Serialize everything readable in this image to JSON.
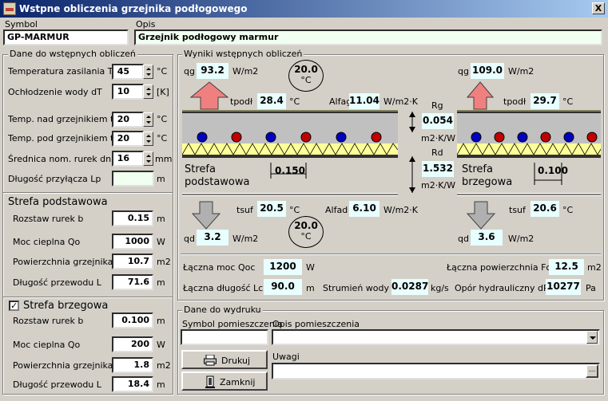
{
  "window": {
    "title": "Wstpne obliczenia grzejnika podłogowego",
    "close": "X"
  },
  "symbol": {
    "label": "Symbol",
    "value": "GP-MARMUR"
  },
  "opis": {
    "label": "Opis",
    "value": "Grzejnik podłogowy marmur"
  },
  "inputs": {
    "title": "Dane do wstępnych obliczeń",
    "tz": {
      "label": "Temperatura zasilania  Tz",
      "value": "45",
      "unit": "°C"
    },
    "dt": {
      "label": "Ochłodzenie wody dT",
      "value": "10",
      "unit": "[K]"
    },
    "tig": {
      "label": "Temp. nad grzejnikiem tig",
      "value": "20",
      "unit": "°C"
    },
    "tid": {
      "label": "Temp. pod grzejnikiem tid",
      "value": "20",
      "unit": "°C"
    },
    "dn": {
      "label": "Średnica nom. rurek dn",
      "value": "16",
      "unit": "mm"
    },
    "lp": {
      "label": "Długość przyłącza Lp",
      "value": "",
      "unit": "m"
    }
  },
  "strefa_podst": {
    "title": "Strefa podstawowa",
    "b": {
      "label": "Rozstaw rurek b",
      "value": "0.15",
      "unit": "m"
    },
    "qo": {
      "label": "Moc cieplna Qo",
      "value": "1000",
      "unit": "W"
    },
    "f": {
      "label": "Powierzchnia grzejnika F",
      "value": "10.7",
      "unit": "m2"
    },
    "l": {
      "label": "Długość przewodu L",
      "value": "71.6",
      "unit": "m"
    }
  },
  "strefa_brzeg": {
    "title": "Strefa brzegowa",
    "checked": "✓",
    "b": {
      "label": "Rozstaw rurek b",
      "value": "0.100",
      "unit": "m"
    },
    "qo": {
      "label": "Moc cieplna Qo",
      "value": "200",
      "unit": "W"
    },
    "f": {
      "label": "Powierzchnia grzejnika F",
      "value": "1.8",
      "unit": "m2"
    },
    "l": {
      "label": "Długość przewodu L",
      "value": "18.4",
      "unit": "m"
    }
  },
  "results": {
    "title": "Wyniki wstępnych obliczeń",
    "left": {
      "qg_label": "qg",
      "qg": "93.2",
      "qg_unit": "W/m2",
      "tig_circle": "20.0",
      "tig_unit": "°C",
      "tpodl_label": "tpodł",
      "tpodl": "28.4",
      "tpodl_unit": "°C",
      "alfag_label": "Alfag",
      "alfag": "11.04",
      "alfag_unit": "W/m2·K",
      "zone_text_1": "Strefa",
      "zone_text_2": "podstawowa",
      "spacing": "0.150",
      "tsuf_label": "tsuf",
      "tsuf": "20.5",
      "tsuf_unit": "°C",
      "alfad_label": "Alfad",
      "alfad": "6.10",
      "alfad_unit": "W/m2·K",
      "tid_circle": "20.0",
      "tid_unit": "°C",
      "qd_label": "qd",
      "qd": "3.2",
      "qd_unit": "W/m2"
    },
    "center": {
      "rg_label": "Rg",
      "rg": "0.054",
      "rg_unit": "m2·K/W",
      "rd_label": "Rd",
      "rd": "1.532",
      "rd_unit": "m2·K/W"
    },
    "right": {
      "qg_label": "qg",
      "qg": "109.0",
      "qg_unit": "W/m2",
      "tpodl_label": "tpodł",
      "tpodl": "29.7",
      "tpodl_unit": "°C",
      "zone_text_1": "Strefa",
      "zone_text_2": "brzegowa",
      "spacing": "0.100",
      "tsuf_label": "tsuf",
      "tsuf": "20.6",
      "tsuf_unit": "°C",
      "qd_label": "qd",
      "qd": "3.6",
      "qd_unit": "W/m2"
    },
    "totals": {
      "qoc_label": "Łączna moc Qoc",
      "qoc": "1200",
      "qoc_unit": "W",
      "fc_label": "Łączna powierzchnia Fc",
      "fc": "12.5",
      "fc_unit": "m2",
      "lc_label": "Łączna długość Lc",
      "lc": "90.0",
      "lc_unit": "m",
      "g_label": "Strumień wody G",
      "g": "0.0287",
      "g_unit": "kg/s",
      "dp_label": "Opór hydrauliczny dP",
      "dp": "10277",
      "dp_unit": "Pa"
    }
  },
  "print": {
    "title": "Dane do wydruku",
    "symbol_label": "Symbol pomieszczenia",
    "opis_label": "Opis pomieszczenia",
    "uwagi_label": "Uwagi",
    "drukuj": "Drukuj",
    "zamknij": "Zamknij",
    "ellipsis": "..."
  },
  "colors": {
    "title_start": "#0a246a",
    "title_end": "#a6caf0",
    "value_bg": "#e8ffff",
    "arrow_up": "#f08080",
    "arrow_down": "#b0b0b0",
    "insulation": "#ffff99",
    "pipe_cold": "#0000c0",
    "pipe_hot": "#c00000"
  }
}
